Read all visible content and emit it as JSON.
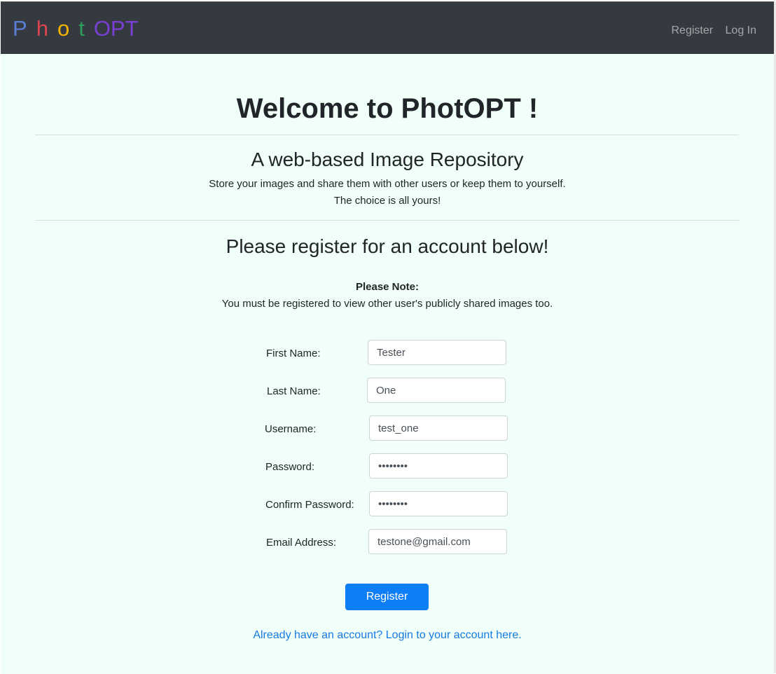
{
  "navbar": {
    "brand_letters": [
      {
        "char": "P",
        "color": "#5b7fd6"
      },
      {
        "char": "h",
        "color": "#e0454f"
      },
      {
        "char": "o",
        "color": "#f4b400"
      },
      {
        "char": "t",
        "color": "#2e9e5a"
      },
      {
        "char": "OPT",
        "color": "#7b3fd6"
      }
    ],
    "links": {
      "register": "Register",
      "login": "Log In"
    }
  },
  "main": {
    "title": "Welcome to PhotOPT !",
    "subtitle": "A web-based Image Repository",
    "description_line1": "Store your images and share them with other users or keep them to yourself.",
    "description_line2": "The choice is all yours!",
    "register_heading": "Please register for an account below!",
    "note_label": "Please Note:",
    "note_text": "You must be registered to view other user's publicly shared images too."
  },
  "form": {
    "first_name": {
      "label": "First Name:",
      "value": "Tester"
    },
    "last_name": {
      "label": "Last Name:",
      "value": "One"
    },
    "username": {
      "label": "Username:",
      "value": "test_one"
    },
    "password": {
      "label": "Password:",
      "value": "password"
    },
    "confirm_password": {
      "label": "Confirm Password:",
      "value": "password"
    },
    "email": {
      "label": "Email Address:",
      "value": "testone@gmail.com"
    },
    "submit_label": "Register",
    "login_link": "Already have an account? Login to your account here."
  },
  "colors": {
    "navbar_bg": "#343a40",
    "page_bg": "#f0fff8",
    "primary": "#0d7ef5",
    "link": "#1a7ae3"
  }
}
